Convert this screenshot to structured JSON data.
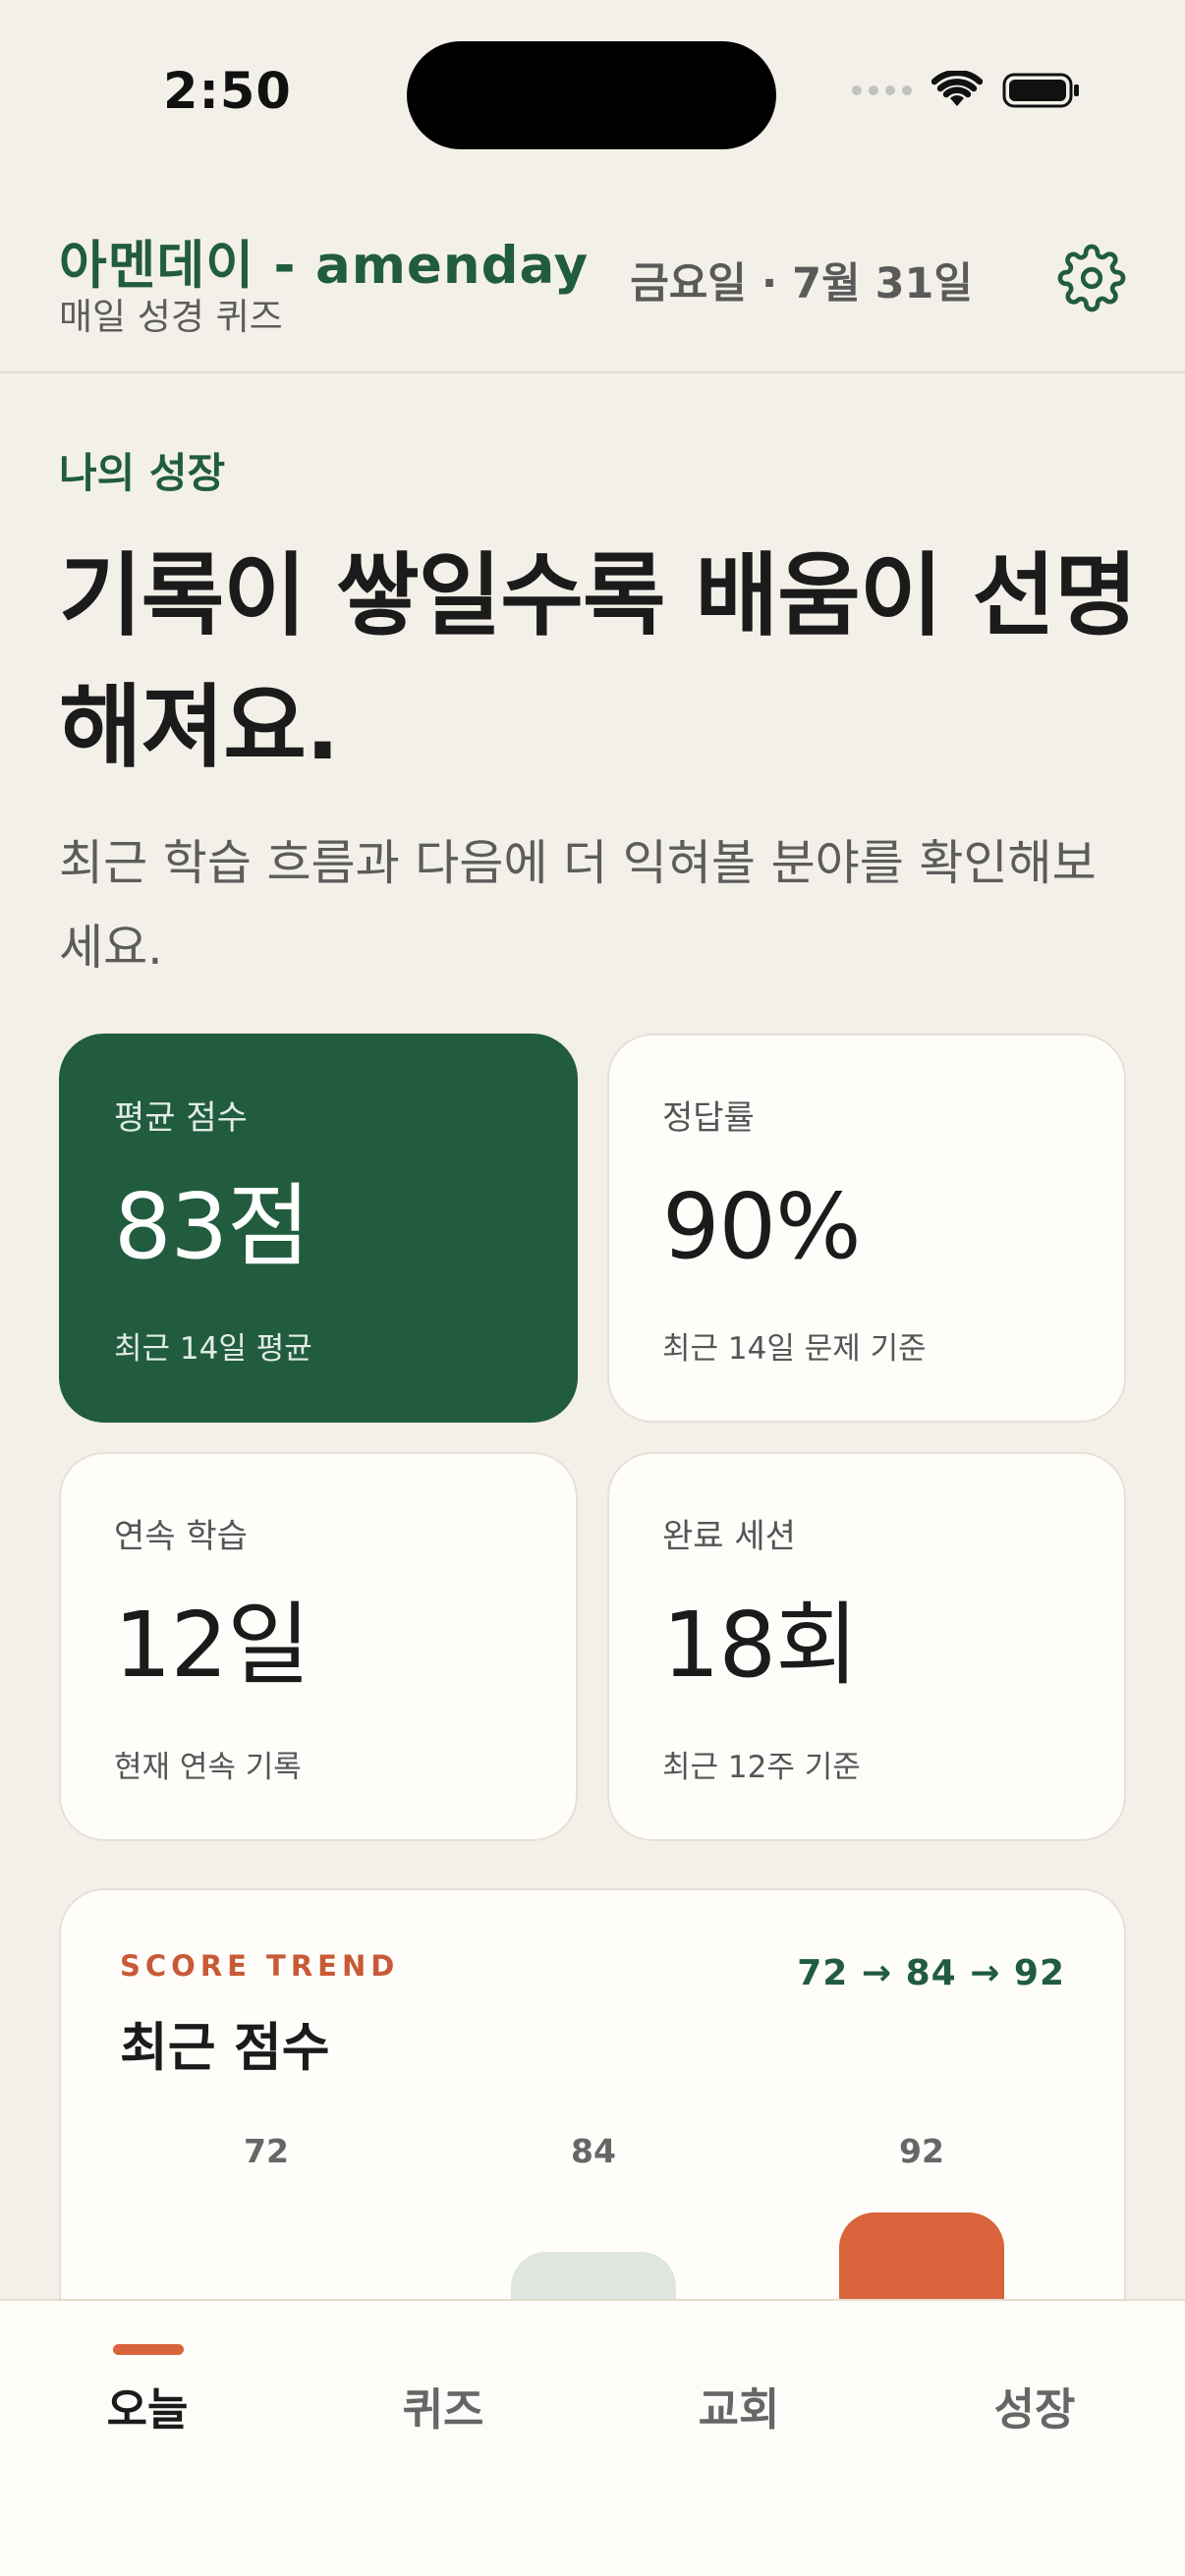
{
  "status_bar": {
    "time": "2:50"
  },
  "header": {
    "app_title": "아멘데이 - amenday",
    "app_subtitle": "매일 성경 퀴즈",
    "date": "금요일 · 7월 31일",
    "settings_icon": "gear-icon"
  },
  "hero": {
    "section_label": "나의 성장",
    "headline": "기록이 쌓일수록 배움이 선명해져요.",
    "description": "최근 학습 흐름과 다음에 더 익혀볼 분야를 확인해보세요."
  },
  "stats": [
    {
      "label": "평균 점수",
      "value": "83점",
      "sub": "최근 14일 평균"
    },
    {
      "label": "정답률",
      "value": "90%",
      "sub": "최근 14일 문제 기준"
    },
    {
      "label": "연속 학습",
      "value": "12일",
      "sub": "현재 연속 기록"
    },
    {
      "label": "완료 세션",
      "value": "18회",
      "sub": "최근 12주 기준"
    }
  ],
  "trend": {
    "kicker": "SCORE TREND",
    "title": "최근 점수",
    "summary": "72 → 84 → 92",
    "chart_data": {
      "type": "bar",
      "values": [
        72,
        84,
        92
      ],
      "value_labels": [
        "72",
        "84",
        "92"
      ],
      "colors": [
        "#dfe5df",
        "#dfe5df",
        "#d9643b"
      ]
    }
  },
  "tabs": [
    {
      "label": "오늘",
      "active": true
    },
    {
      "label": "퀴즈",
      "active": false
    },
    {
      "label": "교회",
      "active": false
    },
    {
      "label": "성장",
      "active": false
    }
  ],
  "colors": {
    "brand_green": "#215c3f",
    "accent_orange": "#d9643b",
    "background": "#f3f0ea"
  }
}
